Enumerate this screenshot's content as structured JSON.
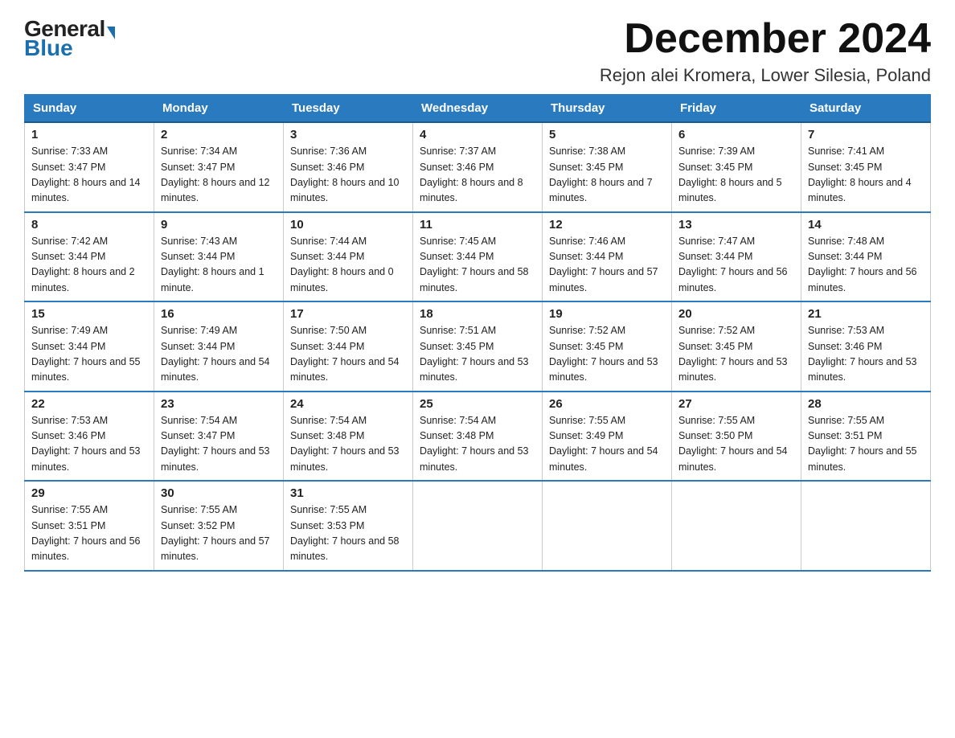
{
  "logo": {
    "general": "General",
    "blue": "Blue"
  },
  "title": "December 2024",
  "subtitle": "Rejon alei Kromera, Lower Silesia, Poland",
  "days_of_week": [
    "Sunday",
    "Monday",
    "Tuesday",
    "Wednesday",
    "Thursday",
    "Friday",
    "Saturday"
  ],
  "weeks": [
    [
      {
        "day": "1",
        "sunrise": "7:33 AM",
        "sunset": "3:47 PM",
        "daylight": "8 hours and 14 minutes."
      },
      {
        "day": "2",
        "sunrise": "7:34 AM",
        "sunset": "3:47 PM",
        "daylight": "8 hours and 12 minutes."
      },
      {
        "day": "3",
        "sunrise": "7:36 AM",
        "sunset": "3:46 PM",
        "daylight": "8 hours and 10 minutes."
      },
      {
        "day": "4",
        "sunrise": "7:37 AM",
        "sunset": "3:46 PM",
        "daylight": "8 hours and 8 minutes."
      },
      {
        "day": "5",
        "sunrise": "7:38 AM",
        "sunset": "3:45 PM",
        "daylight": "8 hours and 7 minutes."
      },
      {
        "day": "6",
        "sunrise": "7:39 AM",
        "sunset": "3:45 PM",
        "daylight": "8 hours and 5 minutes."
      },
      {
        "day": "7",
        "sunrise": "7:41 AM",
        "sunset": "3:45 PM",
        "daylight": "8 hours and 4 minutes."
      }
    ],
    [
      {
        "day": "8",
        "sunrise": "7:42 AM",
        "sunset": "3:44 PM",
        "daylight": "8 hours and 2 minutes."
      },
      {
        "day": "9",
        "sunrise": "7:43 AM",
        "sunset": "3:44 PM",
        "daylight": "8 hours and 1 minute."
      },
      {
        "day": "10",
        "sunrise": "7:44 AM",
        "sunset": "3:44 PM",
        "daylight": "8 hours and 0 minutes."
      },
      {
        "day": "11",
        "sunrise": "7:45 AM",
        "sunset": "3:44 PM",
        "daylight": "7 hours and 58 minutes."
      },
      {
        "day": "12",
        "sunrise": "7:46 AM",
        "sunset": "3:44 PM",
        "daylight": "7 hours and 57 minutes."
      },
      {
        "day": "13",
        "sunrise": "7:47 AM",
        "sunset": "3:44 PM",
        "daylight": "7 hours and 56 minutes."
      },
      {
        "day": "14",
        "sunrise": "7:48 AM",
        "sunset": "3:44 PM",
        "daylight": "7 hours and 56 minutes."
      }
    ],
    [
      {
        "day": "15",
        "sunrise": "7:49 AM",
        "sunset": "3:44 PM",
        "daylight": "7 hours and 55 minutes."
      },
      {
        "day": "16",
        "sunrise": "7:49 AM",
        "sunset": "3:44 PM",
        "daylight": "7 hours and 54 minutes."
      },
      {
        "day": "17",
        "sunrise": "7:50 AM",
        "sunset": "3:44 PM",
        "daylight": "7 hours and 54 minutes."
      },
      {
        "day": "18",
        "sunrise": "7:51 AM",
        "sunset": "3:45 PM",
        "daylight": "7 hours and 53 minutes."
      },
      {
        "day": "19",
        "sunrise": "7:52 AM",
        "sunset": "3:45 PM",
        "daylight": "7 hours and 53 minutes."
      },
      {
        "day": "20",
        "sunrise": "7:52 AM",
        "sunset": "3:45 PM",
        "daylight": "7 hours and 53 minutes."
      },
      {
        "day": "21",
        "sunrise": "7:53 AM",
        "sunset": "3:46 PM",
        "daylight": "7 hours and 53 minutes."
      }
    ],
    [
      {
        "day": "22",
        "sunrise": "7:53 AM",
        "sunset": "3:46 PM",
        "daylight": "7 hours and 53 minutes."
      },
      {
        "day": "23",
        "sunrise": "7:54 AM",
        "sunset": "3:47 PM",
        "daylight": "7 hours and 53 minutes."
      },
      {
        "day": "24",
        "sunrise": "7:54 AM",
        "sunset": "3:48 PM",
        "daylight": "7 hours and 53 minutes."
      },
      {
        "day": "25",
        "sunrise": "7:54 AM",
        "sunset": "3:48 PM",
        "daylight": "7 hours and 53 minutes."
      },
      {
        "day": "26",
        "sunrise": "7:55 AM",
        "sunset": "3:49 PM",
        "daylight": "7 hours and 54 minutes."
      },
      {
        "day": "27",
        "sunrise": "7:55 AM",
        "sunset": "3:50 PM",
        "daylight": "7 hours and 54 minutes."
      },
      {
        "day": "28",
        "sunrise": "7:55 AM",
        "sunset": "3:51 PM",
        "daylight": "7 hours and 55 minutes."
      }
    ],
    [
      {
        "day": "29",
        "sunrise": "7:55 AM",
        "sunset": "3:51 PM",
        "daylight": "7 hours and 56 minutes."
      },
      {
        "day": "30",
        "sunrise": "7:55 AM",
        "sunset": "3:52 PM",
        "daylight": "7 hours and 57 minutes."
      },
      {
        "day": "31",
        "sunrise": "7:55 AM",
        "sunset": "3:53 PM",
        "daylight": "7 hours and 58 minutes."
      },
      null,
      null,
      null,
      null
    ]
  ],
  "labels": {
    "sunrise": "Sunrise:",
    "sunset": "Sunset:",
    "daylight": "Daylight:"
  }
}
